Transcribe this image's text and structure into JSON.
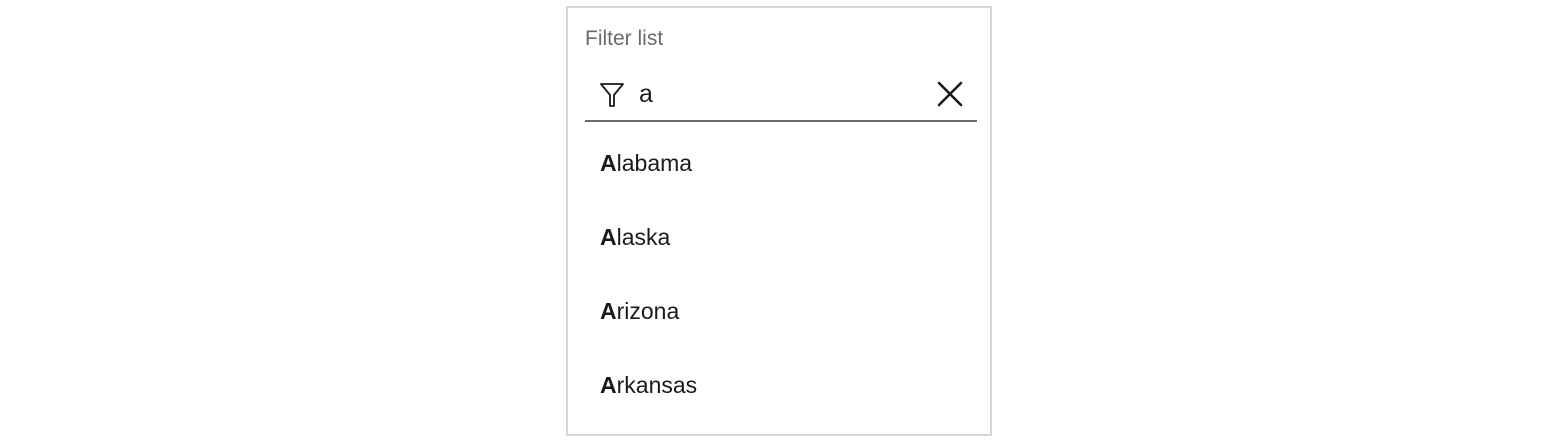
{
  "filter": {
    "label": "Filter list",
    "query": "a",
    "filter_icon": "filter-funnel-icon",
    "clear_icon": "close-icon"
  },
  "results": [
    {
      "match": "A",
      "rest": "labama"
    },
    {
      "match": "A",
      "rest": "laska"
    },
    {
      "match": "A",
      "rest": "rizona"
    },
    {
      "match": "A",
      "rest": "rkansas"
    }
  ]
}
